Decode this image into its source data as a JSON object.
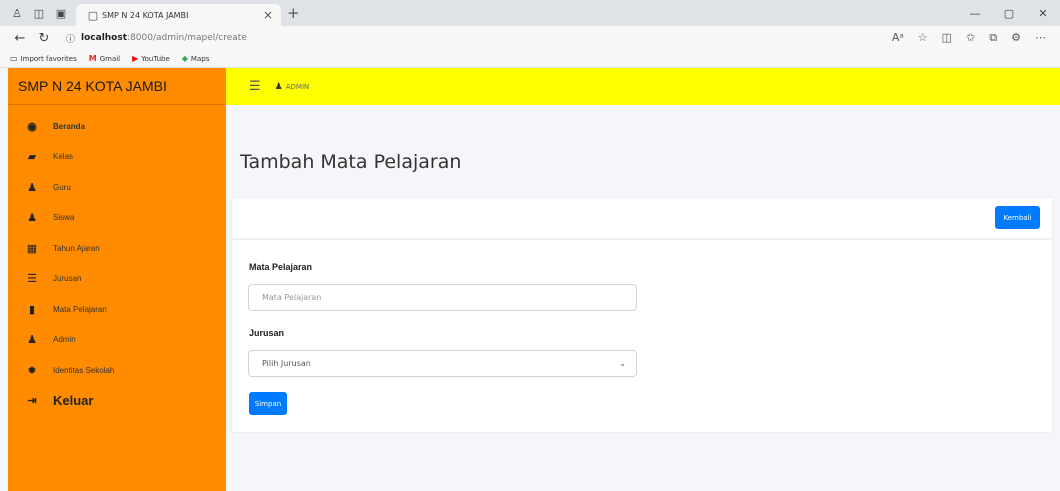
{
  "browser": {
    "tab_title": "SMP N 24 KOTA JAMBI",
    "url_host": "localhost",
    "url_path": ":8000/admin/mapel/create",
    "bookmarks": [
      {
        "label": "Import favorites",
        "icon": "folder-icon"
      },
      {
        "label": "Gmail",
        "icon": "gmail-icon"
      },
      {
        "label": "YouTube",
        "icon": "youtube-icon"
      },
      {
        "label": "Maps",
        "icon": "maps-icon"
      }
    ]
  },
  "sidebar": {
    "brand": "SMP N 24 KOTA JAMBI",
    "items": [
      {
        "label": "Beranda",
        "icon": "dashboard-icon"
      },
      {
        "label": "Kelas",
        "icon": "class-icon"
      },
      {
        "label": "Guru",
        "icon": "user-icon"
      },
      {
        "label": "Siswa",
        "icon": "user-icon"
      },
      {
        "label": "Tahun Ajaran",
        "icon": "calendar-icon"
      },
      {
        "label": "Jurusan",
        "icon": "list-icon"
      },
      {
        "label": "Mata Pelajaran",
        "icon": "book-icon"
      },
      {
        "label": "Admin",
        "icon": "user-icon"
      },
      {
        "label": "Identitas Sekolah",
        "icon": "gear-icon"
      },
      {
        "label": "Keluar",
        "icon": "logout-icon"
      }
    ]
  },
  "topnav": {
    "admin_label": "ADMIN"
  },
  "main": {
    "title": "Tambah Mata Pelajaran",
    "back_button": "Kembali",
    "form": {
      "mapel_label": "Mata Pelajaran",
      "mapel_placeholder": "Mata Pelajaran",
      "jurusan_label": "Jurusan",
      "jurusan_selected": "Pilih Jurusan",
      "save_button": "Simpan"
    }
  },
  "colors": {
    "sidebar": "#ff8c00",
    "navbar": "#ffff00",
    "primary": "#007bff"
  }
}
